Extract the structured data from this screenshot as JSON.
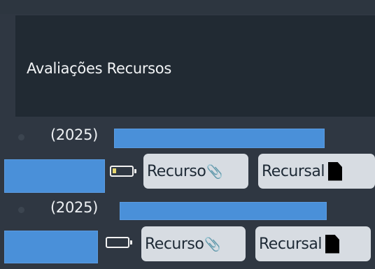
{
  "header": {
    "title": "Avaliações Recursos"
  },
  "items": [
    {
      "year": "(2025)",
      "recurso_label": "Recurso",
      "recursal_label": "Recursal",
      "paperclip_glyph": "📎",
      "battery_level": "low"
    },
    {
      "year": "(2025)",
      "recurso_label": "Recurso",
      "recursal_label": "Recursal",
      "paperclip_glyph": "📎",
      "battery_level": "empty"
    }
  ],
  "colors": {
    "background": "#2f3742",
    "header_panel": "#212a33",
    "pill": "#d7dce2",
    "redaction": "#4a90d9"
  }
}
